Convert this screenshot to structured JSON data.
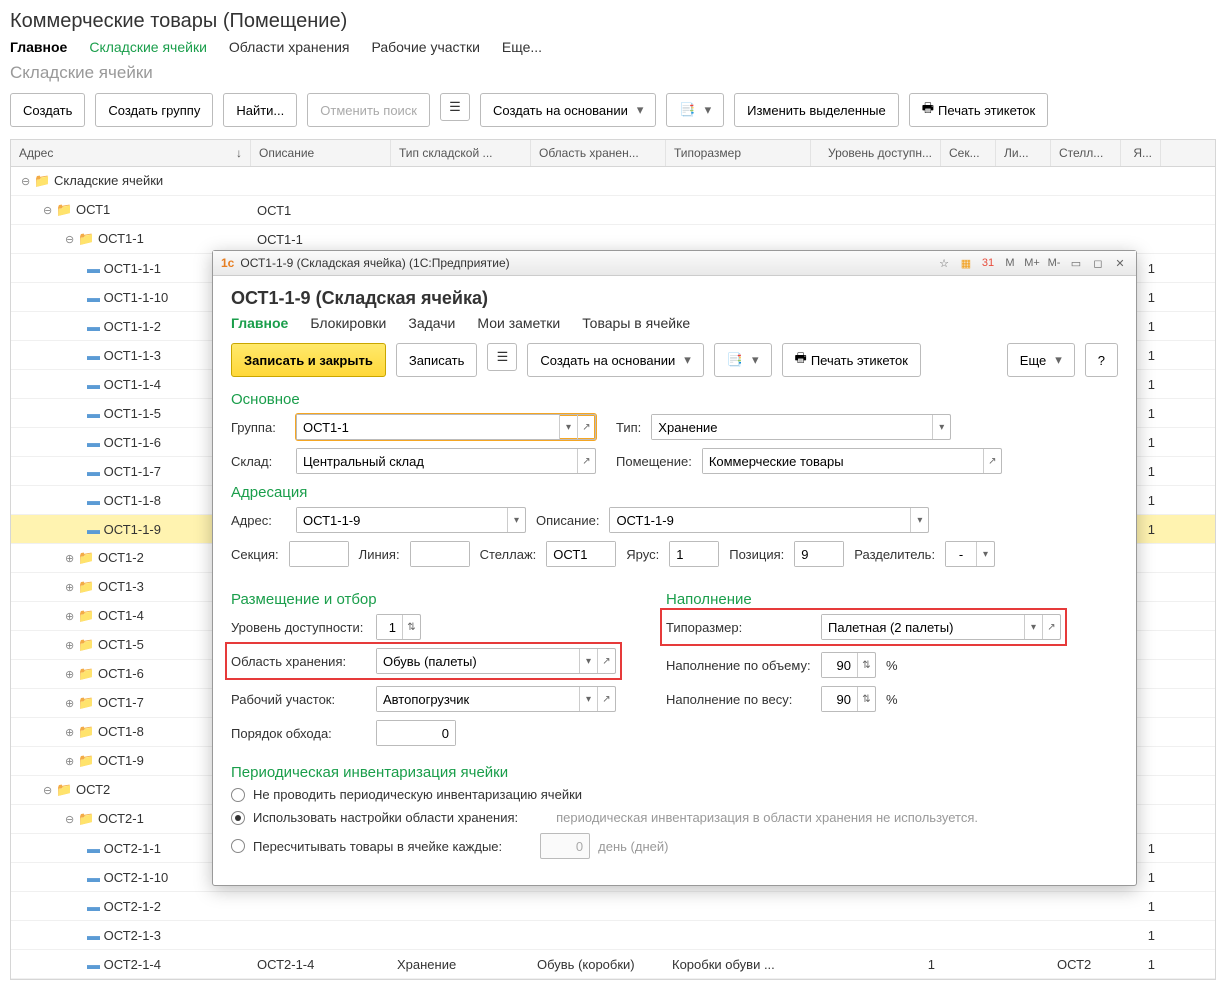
{
  "page": {
    "title": "Коммерческие товары (Помещение)",
    "tabs": [
      "Главное",
      "Складские ячейки",
      "Области хранения",
      "Рабочие участки",
      "Еще..."
    ],
    "subtitle": "Складские ячейки"
  },
  "toolbar": {
    "create": "Создать",
    "create_group": "Создать группу",
    "find": "Найти...",
    "cancel_search": "Отменить поиск",
    "create_based": "Создать на основании",
    "edit_selected": "Изменить выделенные",
    "print_labels": "Печать этикеток"
  },
  "columns": {
    "addr": "Адрес",
    "desc": "Описание",
    "type": "Тип складской ...",
    "area": "Область хранен...",
    "size": "Типоразмер",
    "level": "Уровень доступн...",
    "sec": "Сек...",
    "line": "Ли...",
    "rack": "Стелл...",
    "tier": "Я..."
  },
  "tree": [
    {
      "depth": 0,
      "icon": "folder",
      "expand": "−",
      "label": "Складские ячейки",
      "desc": "",
      "tier": ""
    },
    {
      "depth": 1,
      "icon": "folder",
      "expand": "−",
      "label": "ОСТ1",
      "desc": "ОСТ1",
      "tier": ""
    },
    {
      "depth": 2,
      "icon": "folder",
      "expand": "−",
      "label": "ОСТ1-1",
      "desc": "ОСТ1-1",
      "tier": ""
    },
    {
      "depth": 3,
      "icon": "dash",
      "label": "ОСТ1-1-1",
      "tier": "1"
    },
    {
      "depth": 3,
      "icon": "dash",
      "label": "ОСТ1-1-10",
      "tier": "1"
    },
    {
      "depth": 3,
      "icon": "dash",
      "label": "ОСТ1-1-2",
      "tier": "1"
    },
    {
      "depth": 3,
      "icon": "dash",
      "label": "ОСТ1-1-3",
      "tier": "1"
    },
    {
      "depth": 3,
      "icon": "dash",
      "label": "ОСТ1-1-4",
      "tier": "1"
    },
    {
      "depth": 3,
      "icon": "dash",
      "label": "ОСТ1-1-5",
      "tier": "1"
    },
    {
      "depth": 3,
      "icon": "dash",
      "label": "ОСТ1-1-6",
      "tier": "1"
    },
    {
      "depth": 3,
      "icon": "dash",
      "label": "ОСТ1-1-7",
      "tier": "1"
    },
    {
      "depth": 3,
      "icon": "dash",
      "label": "ОСТ1-1-8",
      "tier": "1"
    },
    {
      "depth": 3,
      "icon": "dash",
      "label": "ОСТ1-1-9",
      "tier": "1",
      "selected": true
    },
    {
      "depth": 2,
      "icon": "folder",
      "expand": "+",
      "label": "ОСТ1-2",
      "tier": ""
    },
    {
      "depth": 2,
      "icon": "folder",
      "expand": "+",
      "label": "ОСТ1-3",
      "tier": ""
    },
    {
      "depth": 2,
      "icon": "folder",
      "expand": "+",
      "label": "ОСТ1-4",
      "tier": ""
    },
    {
      "depth": 2,
      "icon": "folder",
      "expand": "+",
      "label": "ОСТ1-5",
      "tier": ""
    },
    {
      "depth": 2,
      "icon": "folder",
      "expand": "+",
      "label": "ОСТ1-6",
      "tier": ""
    },
    {
      "depth": 2,
      "icon": "folder",
      "expand": "+",
      "label": "ОСТ1-7",
      "tier": ""
    },
    {
      "depth": 2,
      "icon": "folder",
      "expand": "+",
      "label": "ОСТ1-8",
      "tier": ""
    },
    {
      "depth": 2,
      "icon": "folder",
      "expand": "+",
      "label": "ОСТ1-9",
      "tier": ""
    },
    {
      "depth": 1,
      "icon": "folder",
      "expand": "−",
      "label": "ОСТ2",
      "tier": ""
    },
    {
      "depth": 2,
      "icon": "folder",
      "expand": "−",
      "label": "ОСТ2-1",
      "tier": ""
    },
    {
      "depth": 3,
      "icon": "dash",
      "label": "ОСТ2-1-1",
      "tier": "1"
    },
    {
      "depth": 3,
      "icon": "dash",
      "label": "ОСТ2-1-10",
      "tier": "1"
    },
    {
      "depth": 3,
      "icon": "dash",
      "label": "ОСТ2-1-2",
      "tier": "1"
    },
    {
      "depth": 3,
      "icon": "dash",
      "label": "ОСТ2-1-3",
      "tier": "1"
    },
    {
      "depth": 3,
      "icon": "dash",
      "label": "ОСТ2-1-4",
      "desc": "ОСТ2-1-4",
      "type": "Хранение",
      "area": "Обувь (коробки)",
      "size": "Коробки обуви ...",
      "level": "1",
      "rack": "ОСТ2",
      "tier": "1"
    }
  ],
  "dialog": {
    "titlebar": "ОСТ1-1-9 (Складская ячейка)  (1С:Предприятие)",
    "heading": "ОСТ1-1-9 (Складская ячейка)",
    "tabs": [
      "Главное",
      "Блокировки",
      "Задачи",
      "Мои заметки",
      "Товары в ячейке"
    ],
    "actions": {
      "save_close": "Записать и закрыть",
      "save": "Записать",
      "create_based": "Создать на основании",
      "print_labels": "Печать этикеток",
      "more": "Еще"
    },
    "sections": {
      "main_title": "Основное",
      "group_lbl": "Группа:",
      "group_val": "ОСТ1-1",
      "type_lbl": "Тип:",
      "type_val": "Хранение",
      "warehouse_lbl": "Склад:",
      "warehouse_val": "Центральный склад",
      "room_lbl": "Помещение:",
      "room_val": "Коммерческие товары",
      "addr_title": "Адресация",
      "address_lbl": "Адрес:",
      "address_val": "ОСТ1-1-9",
      "desc_lbl": "Описание:",
      "desc_val": "ОСТ1-1-9",
      "section_lbl": "Секция:",
      "section_val": "",
      "line_lbl": "Линия:",
      "line_val": "",
      "rack_lbl": "Стеллаж:",
      "rack_val": "ОСТ1",
      "tier_lbl": "Ярус:",
      "tier_val": "1",
      "pos_lbl": "Позиция:",
      "pos_val": "9",
      "sep_lbl": "Разделитель:",
      "sep_val": "-",
      "place_title": "Размещение и отбор",
      "level_lbl": "Уровень доступности:",
      "level_val": "1",
      "area_lbl": "Область хранения:",
      "area_val": "Обувь (палеты)",
      "workarea_lbl": "Рабочий участок:",
      "workarea_val": "Автопогрузчик",
      "order_lbl": "Порядок обхода:",
      "order_val": "0",
      "fill_title": "Наполнение",
      "size_lbl": "Типоразмер:",
      "size_val": "Палетная (2 палеты)",
      "fill_vol_lbl": "Наполнение по объему:",
      "fill_vol_val": "90",
      "pct": "%",
      "fill_weight_lbl": "Наполнение по весу:",
      "fill_weight_val": "90",
      "inv_title": "Периодическая инвентаризация ячейки",
      "inv_opt1": "Не проводить периодическую инвентаризацию ячейки",
      "inv_opt2": "Использовать настройки области хранения:",
      "inv_opt2_note": "периодическая инвентаризация в области хранения не используется.",
      "inv_opt3": "Пересчитывать товары в ячейке каждые:",
      "inv_opt3_days_val": "0",
      "inv_opt3_days_unit": "день (дней)"
    }
  }
}
